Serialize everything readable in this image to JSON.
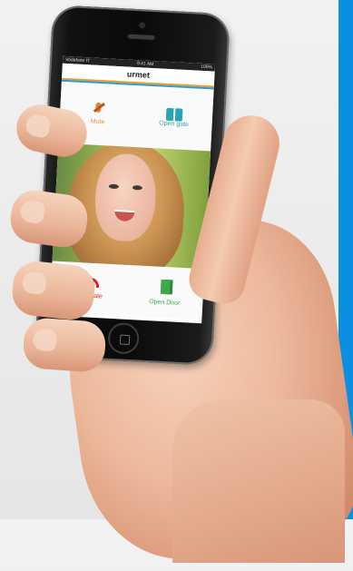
{
  "status_bar": {
    "carrier": "Vodafone IT",
    "time": "9:41 AM",
    "battery": "100%"
  },
  "app": {
    "title": "urmet"
  },
  "actions": {
    "mute": {
      "label": "Mute",
      "icon": "microphone-muted-icon",
      "color": "#e09433"
    },
    "open_gate": {
      "label": "Open gate",
      "icon": "gate-icon",
      "color": "#2aa3b4"
    },
    "terminate": {
      "label": "Terminate",
      "icon": "hang-up-phone-icon",
      "color": "#d6262a"
    },
    "open_door": {
      "label": "Open Door",
      "icon": "door-icon",
      "color": "#3aaa4a"
    }
  },
  "colors": {
    "side_bar": "#0b8fe0",
    "accent_orange": "#f09a2a",
    "accent_blue": "#2a9bd6"
  }
}
